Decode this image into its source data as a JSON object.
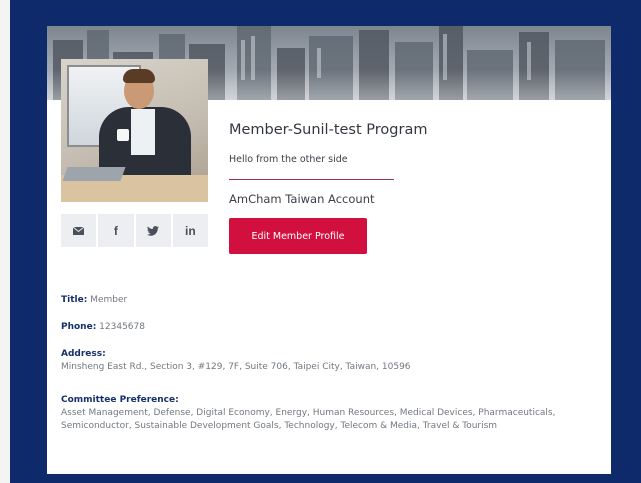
{
  "profile": {
    "name": "Member-Sunil-test Program",
    "greeting": "Hello from the other side",
    "account": "AmCham Taiwan Account",
    "edit_button_label": "Edit Member Profile"
  },
  "social": [
    {
      "icon": "mail-icon",
      "glyph": "✉"
    },
    {
      "icon": "facebook-icon",
      "glyph": "f"
    },
    {
      "icon": "twitter-icon",
      "glyph": "🐦"
    },
    {
      "icon": "linkedin-icon",
      "glyph": "in"
    }
  ],
  "details": {
    "title_label": "Title:",
    "title_value": "Member",
    "phone_label": "Phone:",
    "phone_value": "12345678",
    "address_label": "Address:",
    "address_value": "Minsheng East Rd., Section 3, #129, 7F, Suite 706, Taipei City, Taiwan, 10596",
    "committee_label": "Committee Preference:",
    "committee_value_line1": "Asset Management, Defense, Digital Economy, Energy, Human Resources, Medical Devices, Pharmaceuticals,",
    "committee_value_line2": "Semiconductor, Sustainable Development Goals, Technology, Telecom & Media, Travel & Tourism"
  },
  "colors": {
    "page_background": "#0e2a6b",
    "accent": "#d1103f",
    "label_color": "#16306b"
  }
}
